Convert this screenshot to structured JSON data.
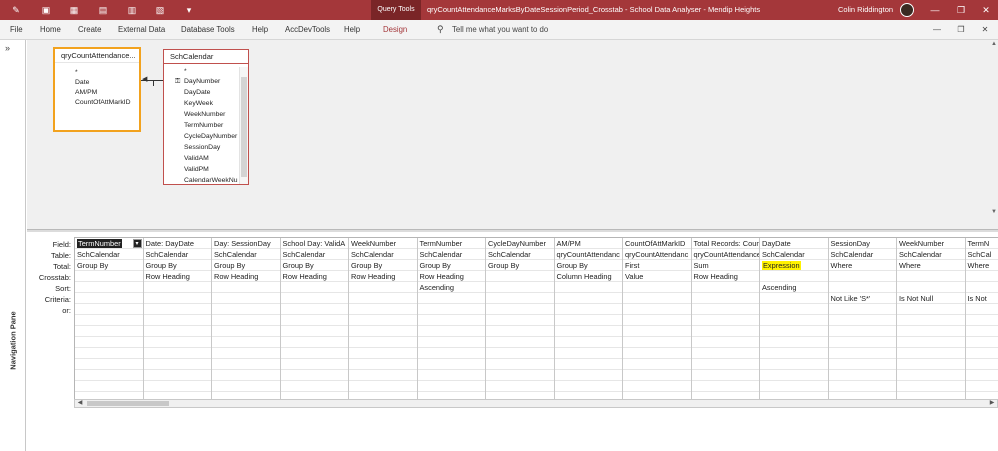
{
  "titlebar": {
    "context_tab": "Query Tools",
    "window_title": "qryCountAttendanceMarksByDateSessionPeriod_Crosstab  -  School Data Analyser - Mendip Heights",
    "user_name": "Colin Riddington",
    "minimize": "—",
    "restore": "❐",
    "close": "✕",
    "accent": "#a4373a"
  },
  "menubar": {
    "items": [
      "File",
      "Home",
      "Create",
      "External Data",
      "Database Tools",
      "Help",
      "AccDevTools",
      "Help",
      "Design"
    ],
    "tell_me": "Tell me what you want to do",
    "doc_minimize": "—",
    "doc_restore": "❐",
    "doc_close": "✕"
  },
  "nav_pane": {
    "label": "Navigation Pane",
    "chevron": "»"
  },
  "tables": {
    "query": {
      "title": "qryCountAttendance...",
      "fields": [
        "*",
        "Date",
        "AM/PM",
        "CountOfAttMarkID"
      ]
    },
    "calendar": {
      "title": "SchCalendar",
      "fields": [
        "*",
        "DayNumber",
        "DayDate",
        "KeyWeek",
        "WeekNumber",
        "TermNumber",
        "CycleDayNumber",
        "SessionDay",
        "ValidAM",
        "ValidPM",
        "CalendarWeekNu"
      ],
      "key_field_index": 1
    }
  },
  "grid": {
    "row_labels": [
      "Field:",
      "Table:",
      "Total:",
      "Crosstab:",
      "Sort:",
      "Criteria:",
      "or:"
    ],
    "columns": [
      {
        "field": "TermNumber",
        "table": "SchCalendar",
        "total": "Group By",
        "crosstab": "",
        "sort": "",
        "criteria": ""
      },
      {
        "field": "Date: DayDate",
        "table": "SchCalendar",
        "total": "Group By",
        "crosstab": "Row Heading",
        "sort": "",
        "criteria": ""
      },
      {
        "field": "Day: SessionDay",
        "table": "SchCalendar",
        "total": "Group By",
        "crosstab": "Row Heading",
        "sort": "",
        "criteria": ""
      },
      {
        "field": "School Day: ValidA",
        "table": "SchCalendar",
        "total": "Group By",
        "crosstab": "Row Heading",
        "sort": "",
        "criteria": ""
      },
      {
        "field": "WeekNumber",
        "table": "SchCalendar",
        "total": "Group By",
        "crosstab": "Row Heading",
        "sort": "",
        "criteria": ""
      },
      {
        "field": "TermNumber",
        "table": "SchCalendar",
        "total": "Group By",
        "crosstab": "Row Heading",
        "sort": "Ascending",
        "criteria": ""
      },
      {
        "field": "CycleDayNumber",
        "table": "SchCalendar",
        "total": "Group By",
        "crosstab": "",
        "sort": "",
        "criteria": ""
      },
      {
        "field": "AM/PM",
        "table": "qryCountAttendanc",
        "total": "Group By",
        "crosstab": "Column Heading",
        "sort": "",
        "criteria": ""
      },
      {
        "field": "CountOfAttMarkID",
        "table": "qryCountAttendanc",
        "total": "First",
        "crosstab": "Value",
        "sort": "",
        "criteria": ""
      },
      {
        "field": "Total Records: Count",
        "table": "qryCountAttendanceM",
        "total": "Sum",
        "crosstab": "Row Heading",
        "sort": "",
        "criteria": ""
      },
      {
        "field": "DayDate",
        "table": "SchCalendar",
        "total": "Expression",
        "crosstab": "",
        "sort": "Ascending",
        "criteria": ""
      },
      {
        "field": "SessionDay",
        "table": "SchCalendar",
        "total": "Where",
        "crosstab": "",
        "sort": "",
        "criteria": "Not Like 'S*'"
      },
      {
        "field": "WeekNumber",
        "table": "SchCalendar",
        "total": "Where",
        "crosstab": "",
        "sort": "",
        "criteria": "Is Not Null"
      },
      {
        "field": "TermN",
        "table": "SchCal",
        "total": "Where",
        "crosstab": "",
        "sort": "",
        "criteria": "Is Not"
      }
    ],
    "highlight_color": "#fff200"
  }
}
